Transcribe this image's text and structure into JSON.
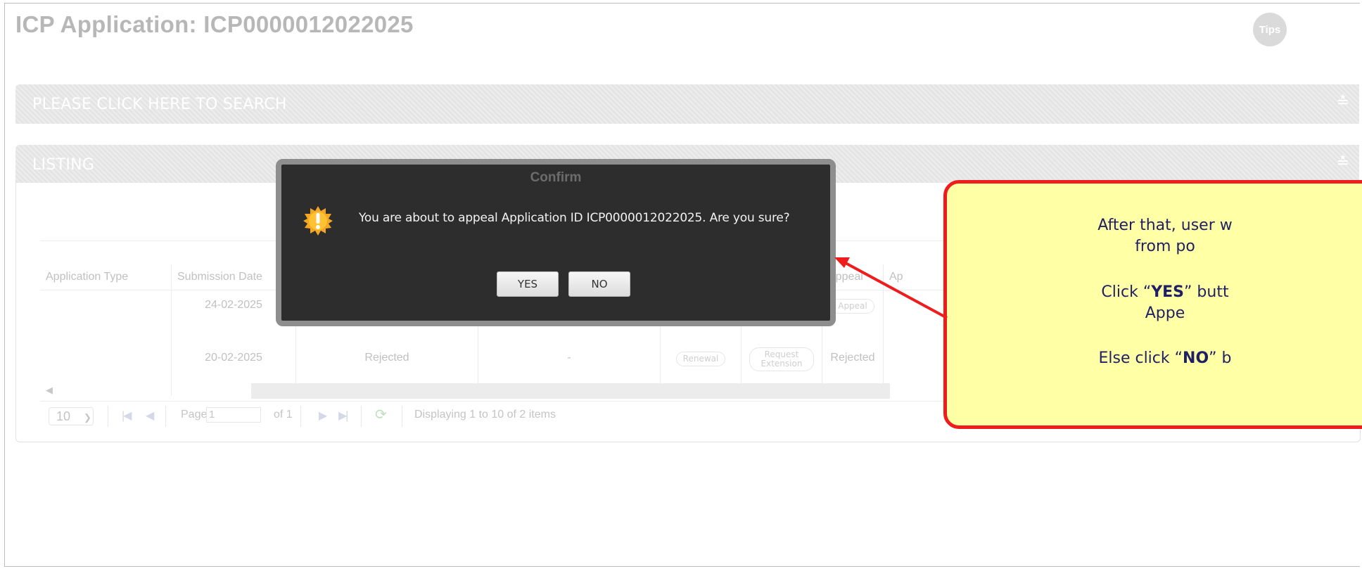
{
  "page": {
    "title": "ICP Application: ICP0000012022025",
    "tips_label": "Tips"
  },
  "search_panel": {
    "label": "PLEASE CLICK HERE TO SEARCH"
  },
  "listing_panel": {
    "label": "LISTING"
  },
  "table": {
    "columns": [
      "Application Type",
      "Submission Date",
      "",
      "",
      "",
      "",
      "Appeal",
      "Ap"
    ],
    "rows": [
      {
        "type": "",
        "submission_date": "24-02-2025",
        "status": "",
        "remark": "",
        "appeal_button": "Appeal",
        "appeal_status": ""
      },
      {
        "type": "",
        "submission_date": "20-02-2025",
        "status": "Rejected",
        "remark": "-",
        "renewal_button": "Renewal",
        "extension_button": "Request Extension",
        "appeal_status": "Rejected"
      }
    ]
  },
  "pager": {
    "page_size": "10",
    "page_label": "Page",
    "page_value": "1",
    "of_label": "of 1",
    "display_text": "Displaying 1 to 10 of 2 items"
  },
  "dialog": {
    "title": "Confirm",
    "message": "You are about to appeal Application ID ICP0000012022025. Are you sure?",
    "yes_label": "YES",
    "no_label": "NO"
  },
  "callout": {
    "line1": "After that, user w",
    "line2": "from po",
    "line3_pre": "Click “",
    "line3_bold": "YES",
    "line3_post": "” butt",
    "line4": "Appe",
    "line5_pre": "Else click “",
    "line5_bold": "NO",
    "line5_post": "” b"
  },
  "colors": {
    "accent_red": "#ee1c1c",
    "callout_bg": "#ffffa6",
    "dialog_bg": "#2d2d2d"
  }
}
